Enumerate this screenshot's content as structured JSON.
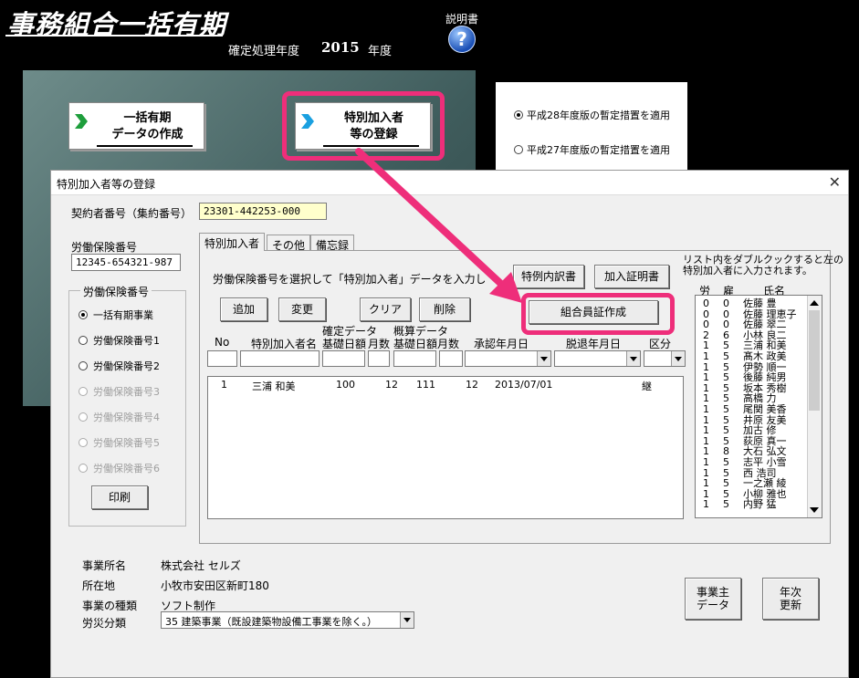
{
  "app": {
    "title": "事務組合一括有期",
    "fiscal_label": "確定処理年度",
    "fiscal_year": "2015",
    "fiscal_unit": "年度",
    "help_label": "説明書",
    "help_icon": "?"
  },
  "menu": {
    "btn1_line1": "一括有期",
    "btn1_line2": "データの作成",
    "btn2_line1": "特別加入者",
    "btn2_line2": "等の登録"
  },
  "options": {
    "opt1": "平成28年度版の暫定措置を適用",
    "opt2": "平成27年度版の暫定措置を適用"
  },
  "dialog": {
    "title": "特別加入者等の登録",
    "close": "✕",
    "contract_label": "契約者番号（集約番号）",
    "contract_value": "23301-442253-000",
    "insurance_label": "労働保険番号",
    "insurance_value": "12345-654321-987",
    "group_label": "労働保険番号",
    "group_items": [
      "一括有期事業",
      "労働保険番号1",
      "労働保険番号2",
      "労働保険番号3",
      "労働保険番号4",
      "労働保険番号5",
      "労働保険番号6"
    ],
    "print_btn": "印刷",
    "tabs": [
      "特別加入者",
      "その他",
      "備忘録"
    ],
    "instruction": "労働保険番号を選択して「特別加入者」データを入力してください。",
    "btn_special": "特例内訳書",
    "btn_certificate": "加入証明書",
    "btn_member_card": "組合員証作成",
    "btn_add": "追加",
    "btn_change": "変更",
    "btn_clear": "クリア",
    "btn_delete": "削除",
    "hdr_confirmed": "確定データ",
    "hdr_estimated": "概算データ",
    "hdr_no": "No",
    "hdr_name": "特別加入者名",
    "hdr_base1": "基礎日額",
    "hdr_months1": "月数",
    "hdr_base2": "基礎日額",
    "hdr_months2": "月数",
    "hdr_approve": "承認年月日",
    "hdr_leave": "脱退年月日",
    "hdr_kubun": "区分",
    "row": {
      "no": "1",
      "name": "三浦 和美",
      "base1": "100",
      "months1": "12",
      "base2": "111",
      "months2": "12",
      "approve": "2013/07/01",
      "kubun": "継"
    },
    "side_note1": "リスト内をダブルクックすると左の",
    "side_note2": "特別加入者に入力されます。",
    "mem_hdr_ro": "労",
    "mem_hdr_ko": "雇",
    "mem_hdr_name": "氏名",
    "members": [
      {
        "ro": "0",
        "ko": "0",
        "name": "佐藤 豊"
      },
      {
        "ro": "0",
        "ko": "0",
        "name": "佐藤 理恵子"
      },
      {
        "ro": "0",
        "ko": "0",
        "name": "佐藤 翠二"
      },
      {
        "ro": "2",
        "ko": "6",
        "name": "小林 良二"
      },
      {
        "ro": "1",
        "ko": "5",
        "name": "三浦 和美"
      },
      {
        "ro": "1",
        "ko": "5",
        "name": "髙木 政美"
      },
      {
        "ro": "1",
        "ko": "5",
        "name": "伊勢 順一"
      },
      {
        "ro": "1",
        "ko": "5",
        "name": "後藤 純男"
      },
      {
        "ro": "1",
        "ko": "5",
        "name": "坂本 秀樹"
      },
      {
        "ro": "1",
        "ko": "5",
        "name": "高橋 力"
      },
      {
        "ro": "1",
        "ko": "5",
        "name": "尾関 美香"
      },
      {
        "ro": "1",
        "ko": "5",
        "name": "井原 友美"
      },
      {
        "ro": "1",
        "ko": "5",
        "name": "加古 修"
      },
      {
        "ro": "1",
        "ko": "5",
        "name": "荻原 真一"
      },
      {
        "ro": "1",
        "ko": "8",
        "name": "大石 弘文"
      },
      {
        "ro": "1",
        "ko": "5",
        "name": "志平 小雪"
      },
      {
        "ro": "1",
        "ko": "5",
        "name": "西 浩司"
      },
      {
        "ro": "1",
        "ko": "5",
        "name": "一之瀬 綾"
      },
      {
        "ro": "1",
        "ko": "5",
        "name": "小柳 雅也"
      },
      {
        "ro": "1",
        "ko": "5",
        "name": "内野 猛"
      }
    ],
    "office_label": "事業所名",
    "office_value": "株式会社 セルズ",
    "address_label": "所在地",
    "address_value": "小牧市安田区新町180",
    "biz_label": "事業の種類",
    "biz_value": "ソフト制作",
    "accident_label": "労災分類",
    "accident_value": "35 建築事業（既設建築物設備工事業を除く。）",
    "btn_employer_1": "事業主",
    "btn_employer_2": "データ",
    "btn_annual_1": "年次",
    "btn_annual_2": "更新"
  },
  "colors": {
    "highlight": "#ee2e7a",
    "menu_chevron_green": "#1e9e3c",
    "menu_chevron_cyan": "#1aa0e0",
    "field_yellow": "#ffffcc"
  }
}
